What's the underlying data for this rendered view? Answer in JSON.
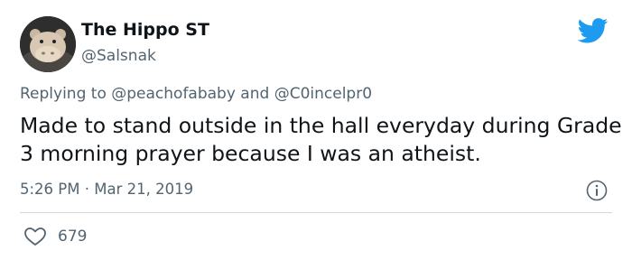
{
  "author": {
    "display_name": "The Hippo ST",
    "handle": "@Salsnak"
  },
  "reply": {
    "prefix": "Replying to ",
    "mention_1": "@peachofababy",
    "joiner": " and ",
    "mention_2": "@C0incelpr0"
  },
  "tweet": {
    "text": "Made to stand outside in the hall everyday during Grade 3 morning prayer because I was an atheist.",
    "timestamp": "5:26 PM · Mar 21, 2019"
  },
  "engagement": {
    "likes": "679"
  },
  "colors": {
    "brand": "#1d9bf0",
    "secondary_text": "#536471",
    "divider": "#cfd9de"
  },
  "icons": [
    "twitter-bird-icon",
    "info-icon",
    "heart-icon"
  ]
}
